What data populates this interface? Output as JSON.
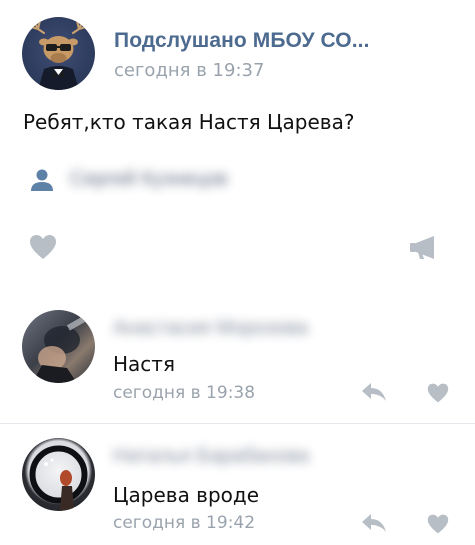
{
  "post": {
    "group_name": "Подслушано МБОУ СО...",
    "time": "сегодня в 19:37",
    "text": "Ребят,кто такая Настя Царева?",
    "avatar_icon": "moose-mascot-icon",
    "signer_name": "Сергей Кузнецов",
    "actions": {
      "like_icon": "heart-icon",
      "repost_icon": "megaphone-icon"
    }
  },
  "comments": [
    {
      "author": "Анастасия Морозова",
      "text": "Настя",
      "time": "сегодня в 19:38",
      "avatar_icon": "user-photo-avatar",
      "reply_icon": "reply-arrow-icon",
      "like_icon": "heart-icon"
    },
    {
      "author": "Наталья Барабанова",
      "text": "Царева вроде",
      "time": "сегодня в 19:42",
      "avatar_icon": "user-photo-avatar",
      "reply_icon": "reply-arrow-icon",
      "like_icon": "heart-icon"
    }
  ],
  "colors": {
    "link": "#4d6a8f",
    "meta": "#9aa3ad",
    "icon": "#b7bec6",
    "person_icon": "#5e81a8",
    "divider": "#e3e6ea"
  }
}
